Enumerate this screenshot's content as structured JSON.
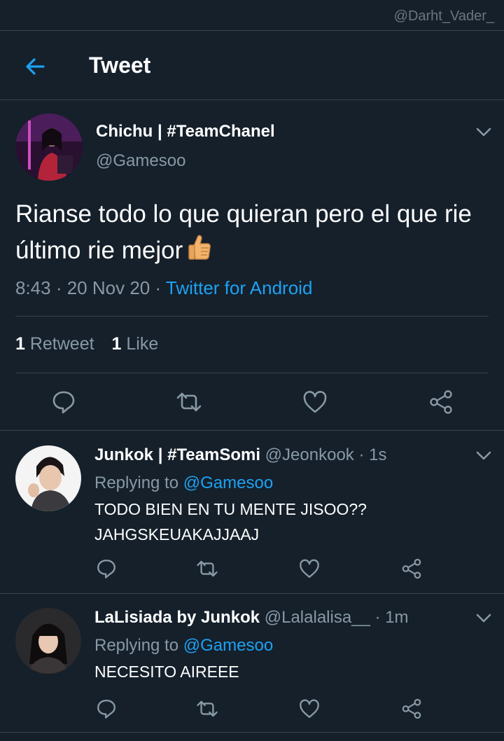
{
  "watermark": "@Darht_Vader_",
  "header": {
    "title": "Tweet"
  },
  "tweet": {
    "display_name": "Chichu | #TeamChanel",
    "handle": "@Gamesoo",
    "text": "Rianse todo lo que quieran pero el que rie último rie mejor",
    "emoji_icon": "thumbs-up-icon",
    "time": "8:43 · 20 Nov 20 · ",
    "source": "Twitter for Android",
    "retweets": {
      "count": "1",
      "label": " Retweet"
    },
    "likes": {
      "count": "1",
      "label": " Like"
    }
  },
  "replies": [
    {
      "display_name": "Junkok | #TeamSomi",
      "handle_time": " @Jeonkook · 1s",
      "replying_label": "Replying to ",
      "replying_to": "@Gamesoo",
      "text_line1": "TODO BIEN EN TU MENTE JISOO??",
      "text_line2": "JAHGSKEUAKAJJAAJ"
    },
    {
      "display_name": "LaLisiada by Junkok",
      "handle_time": " @Lalalalisa__ · 1m",
      "replying_label": "Replying to ",
      "replying_to": "@Gamesoo",
      "text_line1": "NECESITO AIREEE",
      "text_line2": ""
    }
  ],
  "colors": {
    "background": "#15202b",
    "accent": "#1da1f2",
    "secondary_text": "#8899a6",
    "divider": "#38444d"
  }
}
